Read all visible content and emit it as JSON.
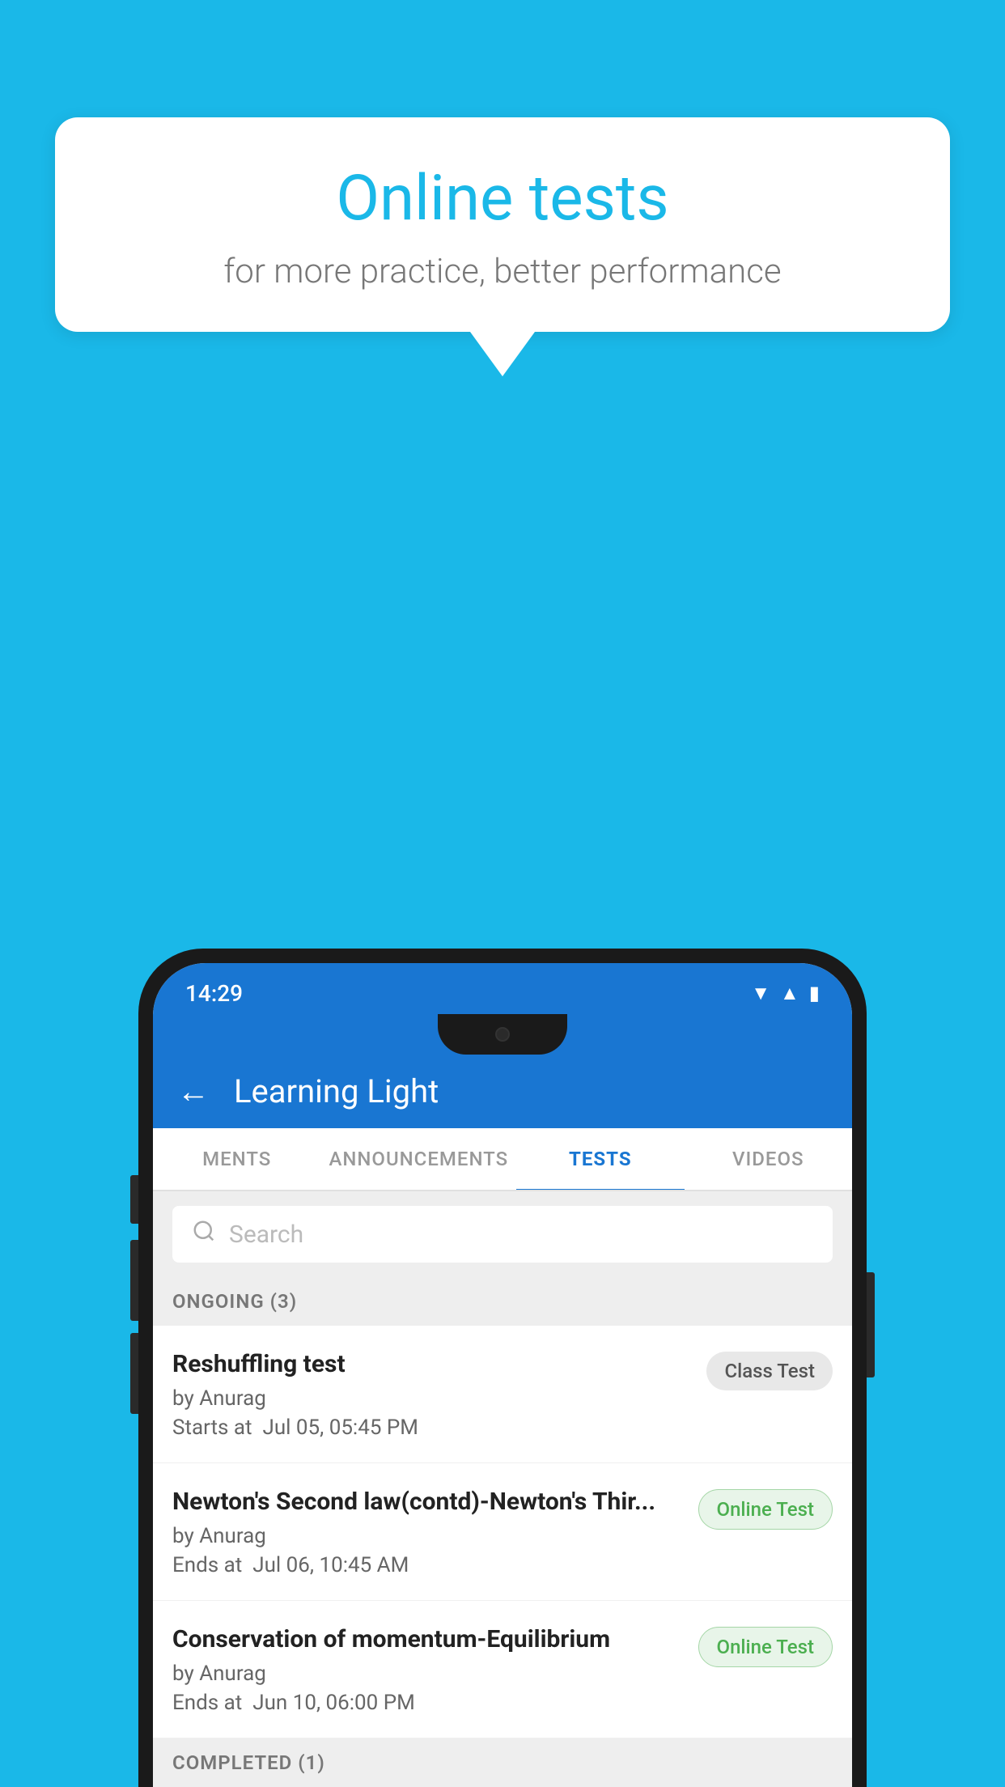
{
  "bubble": {
    "title": "Online tests",
    "subtitle": "for more practice, better performance"
  },
  "phone": {
    "status_bar": {
      "time": "14:29",
      "icons": [
        "wifi",
        "signal",
        "battery"
      ]
    },
    "app_bar": {
      "back_label": "←",
      "title": "Learning Light"
    },
    "tabs": [
      {
        "label": "MENTS",
        "active": false
      },
      {
        "label": "ANNOUNCEMENTS",
        "active": false
      },
      {
        "label": "TESTS",
        "active": true
      },
      {
        "label": "VIDEOS",
        "active": false
      }
    ],
    "search": {
      "placeholder": "Search"
    },
    "ongoing_section": {
      "header": "ONGOING (3)",
      "items": [
        {
          "name": "Reshuffling test",
          "author": "by Anurag",
          "time_label": "Starts at",
          "time": "Jul 05, 05:45 PM",
          "badge": "Class Test",
          "badge_type": "class"
        },
        {
          "name": "Newton's Second law(contd)-Newton's Thir...",
          "author": "by Anurag",
          "time_label": "Ends at",
          "time": "Jul 06, 10:45 AM",
          "badge": "Online Test",
          "badge_type": "online"
        },
        {
          "name": "Conservation of momentum-Equilibrium",
          "author": "by Anurag",
          "time_label": "Ends at",
          "time": "Jun 10, 06:00 PM",
          "badge": "Online Test",
          "badge_type": "online"
        }
      ]
    },
    "completed_section": {
      "header": "COMPLETED (1)"
    }
  }
}
